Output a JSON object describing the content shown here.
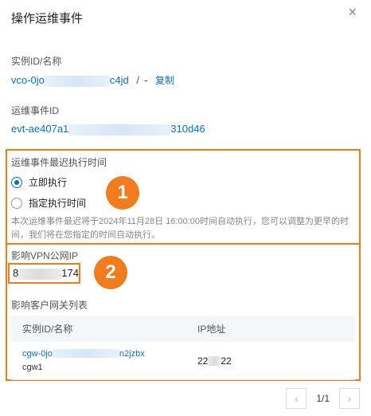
{
  "dialog": {
    "title": "操作运维事件",
    "close_icon": "×"
  },
  "instance": {
    "label": "实例ID/名称",
    "id_start": "vco-0jo",
    "id_end": "c4jd",
    "separator": "/",
    "name": "-",
    "copy_label": "复制"
  },
  "event": {
    "label": "运维事件ID",
    "id_start": "evt-ae407a1",
    "id_end": "310d46"
  },
  "schedule": {
    "label": "运维事件最迟执行时间",
    "options": [
      {
        "label": "立即执行",
        "checked": true
      },
      {
        "label": "指定执行时间",
        "checked": false
      }
    ],
    "hint": "本次运维事件最迟将于2024年11月28日 16:00:00时间自动执行，您可以调整为更早的时间，我们将在您指定的时间自动执行。"
  },
  "badges": {
    "one": "1",
    "two": "2"
  },
  "vpn_ip": {
    "label": "影响VPN公网IP",
    "value_start": "8",
    "value_end": "174"
  },
  "gateways": {
    "label": "影响客户网关列表",
    "columns": [
      "实例ID/名称",
      "IP地址"
    ],
    "rows": [
      {
        "id_start": "cgw-0jo",
        "id_end": "n2jzbx",
        "name": "cgw1",
        "ip_start": "22",
        "ip_end": "22"
      }
    ]
  },
  "pagination": {
    "prev_icon": "‹",
    "next_icon": "›",
    "text": "1/1"
  },
  "colors": {
    "accent": "#0b6fc7",
    "highlight": "#f07c1e"
  }
}
